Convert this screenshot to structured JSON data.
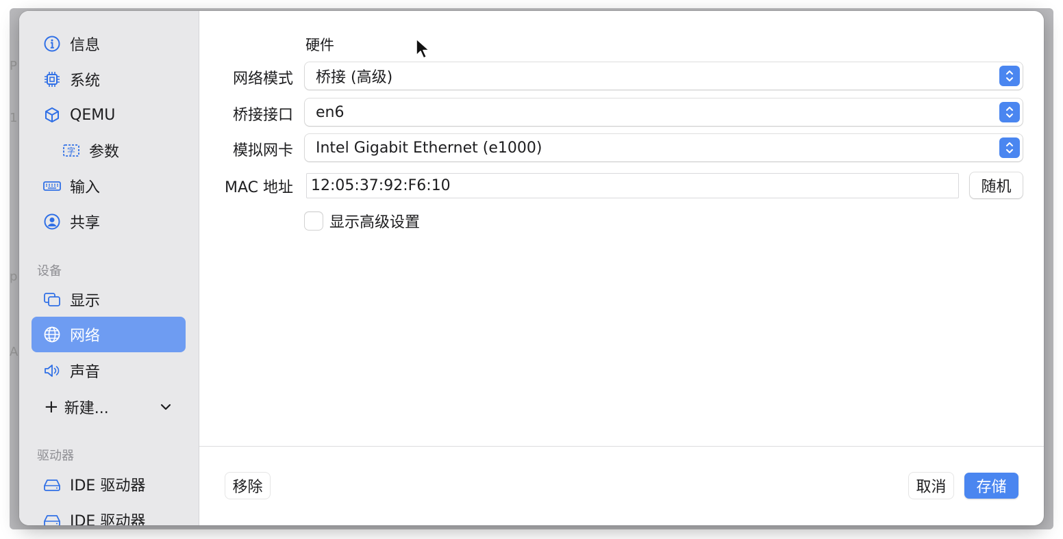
{
  "sidebar": {
    "items": [
      {
        "label": "信息",
        "icon": "info-icon"
      },
      {
        "label": "系统",
        "icon": "cpu-chip-icon"
      },
      {
        "label": "QEMU",
        "icon": "cube-icon"
      },
      {
        "label": "参数",
        "icon": "character-textbox-icon"
      },
      {
        "label": "输入",
        "icon": "keyboard-icon"
      },
      {
        "label": "共享",
        "icon": "person-circle-icon"
      }
    ],
    "devices_section": "设备",
    "device_items": [
      {
        "label": "显示",
        "icon": "display-windows-icon"
      },
      {
        "label": "网络",
        "icon": "globe-icon",
        "active": true
      },
      {
        "label": "声音",
        "icon": "speaker-icon"
      }
    ],
    "new_label": "新建...",
    "drives_section": "驱动器",
    "drive_items": [
      {
        "label": "IDE 驱动器",
        "icon": "internal-drive-icon"
      },
      {
        "label": "IDE 驱动器",
        "icon": "internal-drive-icon"
      }
    ]
  },
  "form": {
    "section_title": "硬件",
    "network_mode_label": "网络模式",
    "network_mode_value": "桥接 (高级)",
    "bridge_interface_label": "桥接接口",
    "bridge_interface_value": "en6",
    "emulated_card_label": "模拟网卡",
    "emulated_card_value": "Intel Gigabit Ethernet (e1000)",
    "mac_label": "MAC 地址",
    "mac_value": "12:05:37:92:F6:10",
    "random_button": "随机",
    "advanced_checkbox_label": "显示高级设置",
    "advanced_checked": false
  },
  "footer": {
    "remove_button": "移除",
    "cancel_button": "取消",
    "save_button": "存储"
  },
  "colors": {
    "accent": "#4a86f0",
    "sidebar_selection": "#6e9cf2",
    "sidebar_bg": "#e8e8ea"
  }
}
